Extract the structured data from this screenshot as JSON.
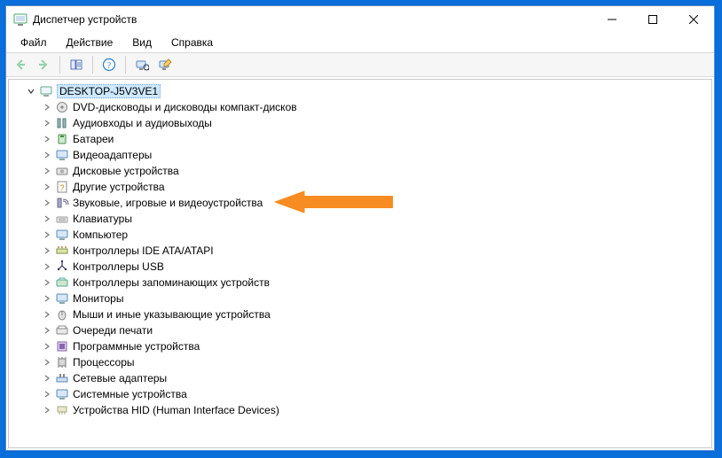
{
  "window": {
    "title": "Диспетчер устройств"
  },
  "menu": {
    "file": "Файл",
    "action": "Действие",
    "view": "Вид",
    "help": "Справка"
  },
  "tree": {
    "root": "DESKTOP-J5V3VE1",
    "items": [
      "DVD-дисководы и дисководы компакт-дисков",
      "Аудиовходы и аудиовыходы",
      "Батареи",
      "Видеоадаптеры",
      "Дисковые устройства",
      "Другие устройства",
      "Звуковые, игровые и видеоустройства",
      "Клавиатуры",
      "Компьютер",
      "Контроллеры IDE ATA/ATAPI",
      "Контроллеры USB",
      "Контроллеры запоминающих устройств",
      "Мониторы",
      "Мыши и иные указывающие устройства",
      "Очереди печати",
      "Программные устройства",
      "Процессоры",
      "Сетевые адаптеры",
      "Системные устройства",
      "Устройства HID (Human Interface Devices)"
    ]
  }
}
